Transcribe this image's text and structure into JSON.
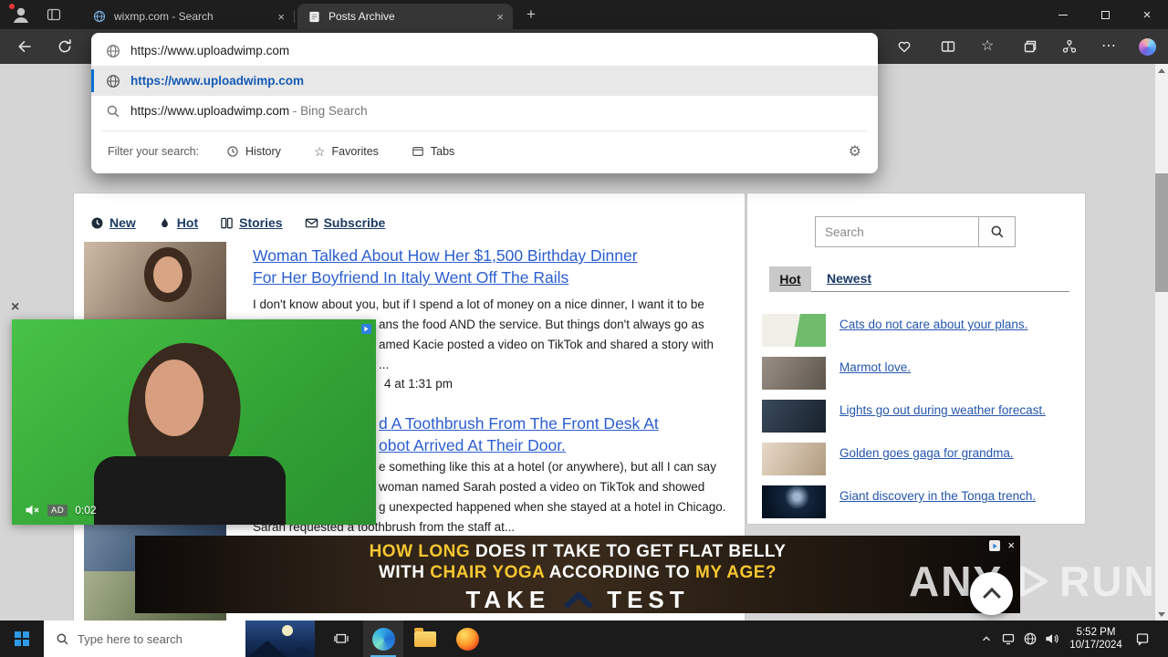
{
  "browser": {
    "tabs": [
      {
        "title": "wixmp.com - Search"
      },
      {
        "title": "Posts Archive"
      }
    ],
    "address_url": "https://www.uploadwimp.com",
    "omnibox": {
      "url_suggestion": "https://www.uploadwimp.com",
      "search_suggestion": "https://www.uploadwimp.com",
      "search_suffix": " - Bing Search",
      "filter_label": "Filter your search:",
      "filter_history": "History",
      "filter_favorites": "Favorites",
      "filter_tabs": "Tabs"
    }
  },
  "icons": {
    "close": "×",
    "plus": "+",
    "more": "⋯",
    "gear": "⚙",
    "star": "☆"
  },
  "content": {
    "nav": {
      "new": "New",
      "hot": "Hot",
      "stories": "Stories",
      "subscribe": "Subscribe"
    },
    "article1": {
      "title_line1": "Woman Talked About How Her $1,500 Birthday Dinner",
      "title_line2": "For Her Boyfriend In Italy Went Off The Rails",
      "body_line1": "I don't know about you, but if I spend a lot of money on a nice dinner, I want it to be",
      "body_line2": "ans the food AND the service. But things don't always go as",
      "body_line3": "amed Kacie posted a video on TikTok and shared a story with",
      "body_line4": "...",
      "date_fragment": "4 at 1:31 pm"
    },
    "article2": {
      "title_line1": "d A Toothbrush From The Front Desk At",
      "title_line2": "obot Arrived At Their Door.",
      "body_line1": "e something like this at a hotel (or anywhere), but all I can say",
      "body_line2": "woman named Sarah posted a video on TikTok and showed",
      "body_line3": "g unexpected happened when she stayed at a hotel in Chicago.",
      "body_line4": "Sarah requested a toothbrush from the staff at..."
    },
    "sidebar": {
      "search_placeholder": "Search",
      "tab_hot": "Hot",
      "tab_newest": "Newest",
      "items": [
        {
          "label": "Cats do not care about your plans."
        },
        {
          "label": "Marmot love."
        },
        {
          "label": "Lights go out during weather forecast."
        },
        {
          "label": "Golden goes gaga for grandma."
        },
        {
          "label": "Giant discovery in the Tonga trench."
        }
      ]
    },
    "video_ad": {
      "ad_badge": "AD",
      "time": "0:02"
    },
    "banner_ad": {
      "l1a": "HOW LONG ",
      "l1b": "DOES IT TAKE TO GET FLAT BELLY",
      "l2a": "WITH ",
      "l2b": "CHAIR YOGA",
      "l2c": " ACCORDING TO ",
      "l2d": "MY AGE?",
      "cta1": "TAKE",
      "cta2": "TEST"
    },
    "watermark": {
      "left": "ANY",
      "right": "RUN"
    }
  },
  "taskbar": {
    "search_placeholder": "Type here to search",
    "time": "5:52 PM",
    "date": "10/17/2024"
  },
  "colors": {
    "accent_blue": "#0b6fd0",
    "link_blue": "#2b5ed1",
    "ad_gold": "#f7c631"
  }
}
